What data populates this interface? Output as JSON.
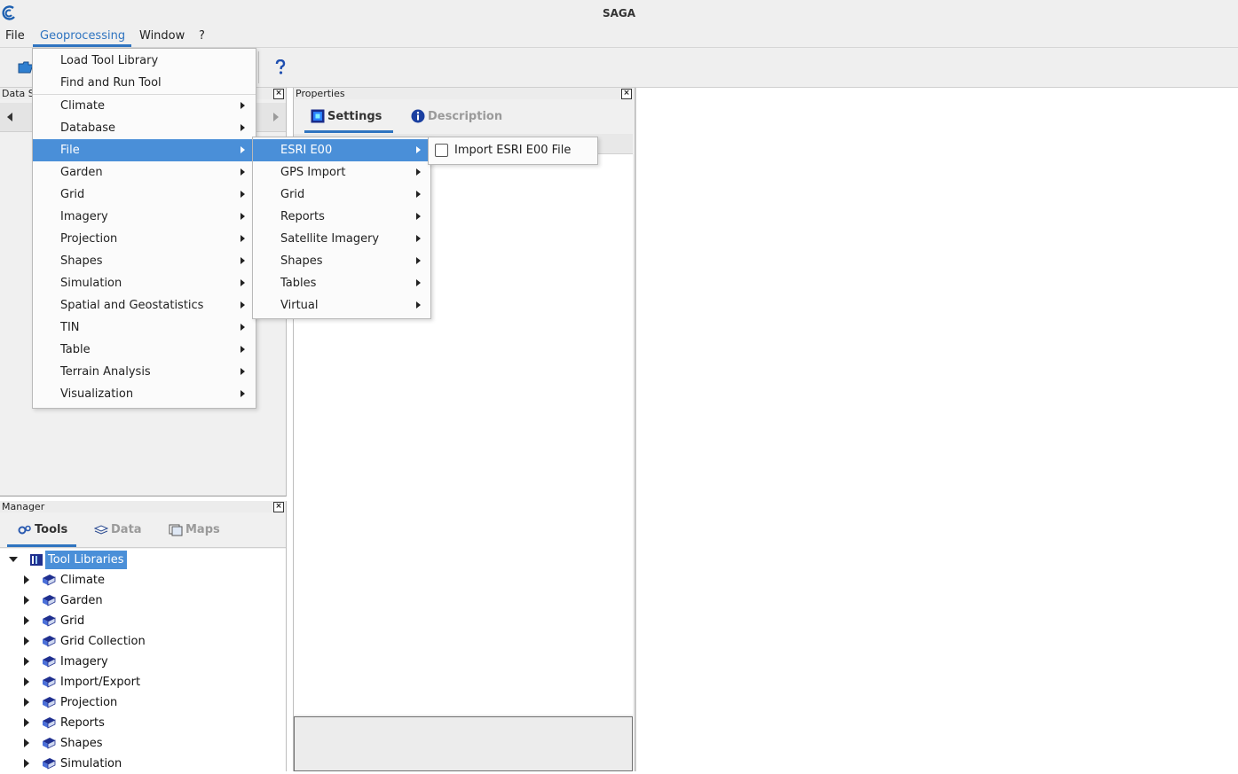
{
  "window": {
    "title": "SAGA"
  },
  "menubar": [
    "File",
    "Geoprocessing",
    "Window",
    "?"
  ],
  "geoprocessing_menu": {
    "top_items": [
      "Load Tool Library",
      "Find and Run Tool"
    ],
    "categories": [
      "Climate",
      "Database",
      "File",
      "Garden",
      "Grid",
      "Imagery",
      "Projection",
      "Shapes",
      "Simulation",
      "Spatial and Geostatistics",
      "TIN",
      "Table",
      "Terrain Analysis",
      "Visualization"
    ],
    "highlighted": "File"
  },
  "file_submenu": {
    "items": [
      "ESRI E00",
      "GPS Import",
      "Grid",
      "Reports",
      "Satellite Imagery",
      "Shapes",
      "Tables",
      "Virtual"
    ],
    "highlighted": "ESRI E00"
  },
  "esri_submenu": {
    "items": [
      "Import ESRI E00 File"
    ]
  },
  "data_sources_panel": {
    "title": "Data S"
  },
  "properties_panel": {
    "title": "Properties",
    "tabs": [
      "Settings",
      "Description"
    ],
    "active_tab": "Settings"
  },
  "manager_panel": {
    "title": "Manager",
    "tabs": [
      "Tools",
      "Data",
      "Maps"
    ],
    "active_tab": "Tools",
    "tree_root": "Tool Libraries",
    "tree_items": [
      "Climate",
      "Garden",
      "Grid",
      "Grid Collection",
      "Imagery",
      "Import/Export",
      "Projection",
      "Reports",
      "Shapes",
      "Simulation"
    ]
  },
  "colors": {
    "accent": "#2f74c0",
    "menu_highlight": "#4a8fd8",
    "book_icon": "#1f2f8f"
  }
}
